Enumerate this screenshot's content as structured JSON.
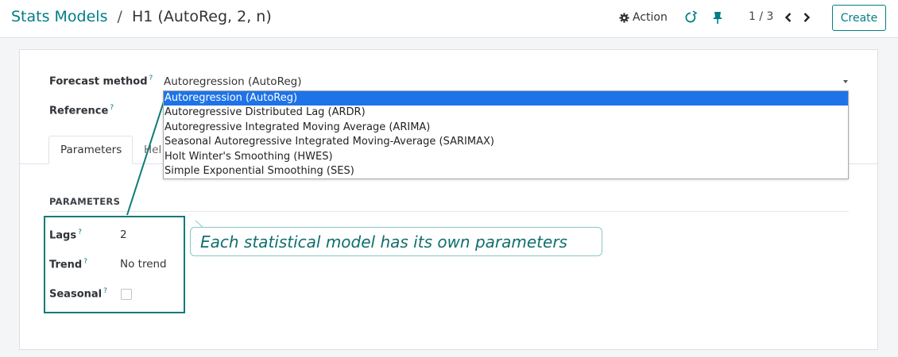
{
  "breadcrumb": {
    "parent": "Stats Models",
    "separator": "/",
    "current": "H1 (AutoReg, 2, n)"
  },
  "toolbar": {
    "action_label": "Action",
    "pager": "1 / 3",
    "create_label": "Create"
  },
  "form": {
    "forecast_method": {
      "label": "Forecast method",
      "help": "?",
      "value": "Autoregression (AutoReg)"
    },
    "reference": {
      "label": "Reference",
      "help": "?"
    }
  },
  "tabs": [
    {
      "label": "Parameters"
    },
    {
      "label": "Hel"
    }
  ],
  "parameters": {
    "section_title": "PARAMETERS",
    "lags": {
      "label": "Lags",
      "help": "?",
      "value": "2"
    },
    "trend": {
      "label": "Trend",
      "help": "?",
      "value": "No trend"
    },
    "seasonal": {
      "label": "Seasonal",
      "help": "?",
      "checked": false
    }
  },
  "dropdown": {
    "options": [
      "Autoregression (AutoReg)",
      "Autoregressive Distributed Lag (ARDR)",
      "Autoregressive Integrated Moving Average (ARIMA)",
      "Seasonal Autoregressive Integrated Moving-Average (SARIMAX)",
      "Holt Winter's Smoothing (HWES)",
      "Simple Exponential Smoothing (SES)"
    ],
    "selected_index": 0
  },
  "annotation": {
    "text": "Each statistical model has its own parameters"
  },
  "colors": {
    "accent": "#017e84",
    "highlight": "#0f7b78",
    "selected_option": "#1e73e8"
  },
  "icons": {
    "action": "gear-icon",
    "refresh": "refresh-icon",
    "pin": "pin-icon",
    "prev": "chevron-left-icon",
    "next": "chevron-right-icon"
  }
}
